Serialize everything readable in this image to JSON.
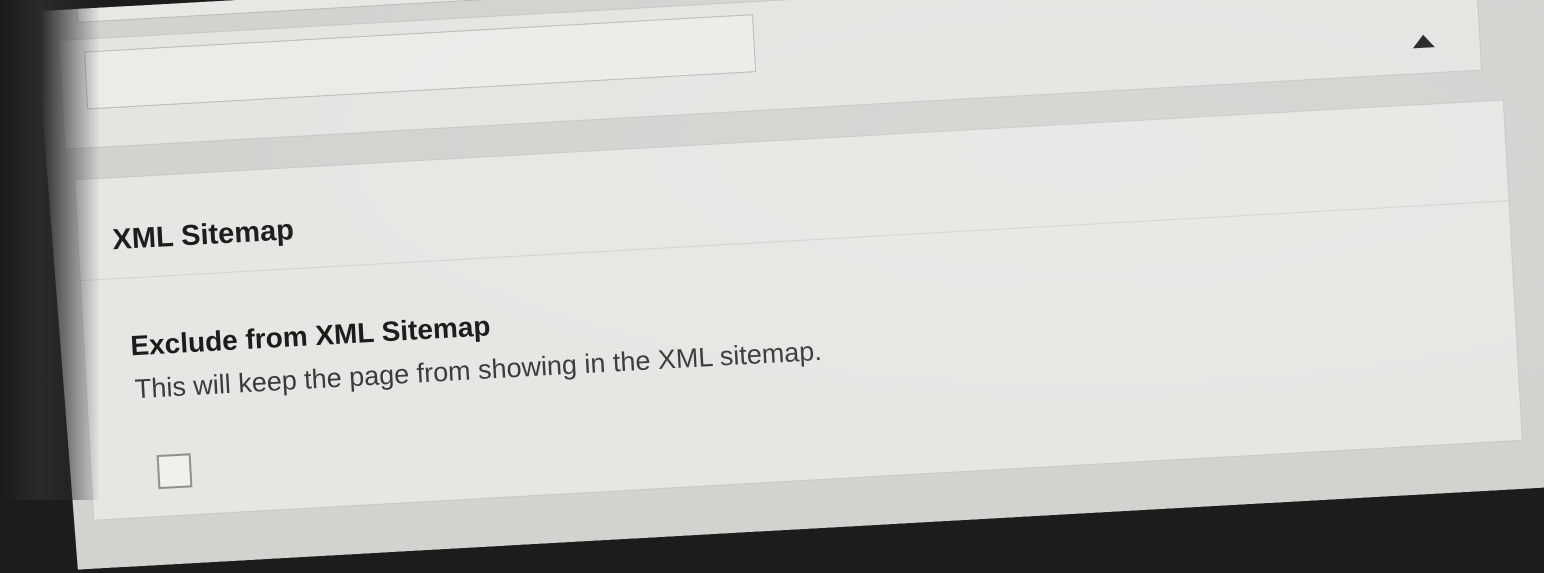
{
  "panel": {
    "toggle_icon": "triangle-up-icon"
  },
  "xml_sitemap": {
    "title": "XML Sitemap",
    "option_label": "Exclude from XML Sitemap",
    "option_description": "This will keep the page from showing in the XML sitemap.",
    "checked": false
  }
}
